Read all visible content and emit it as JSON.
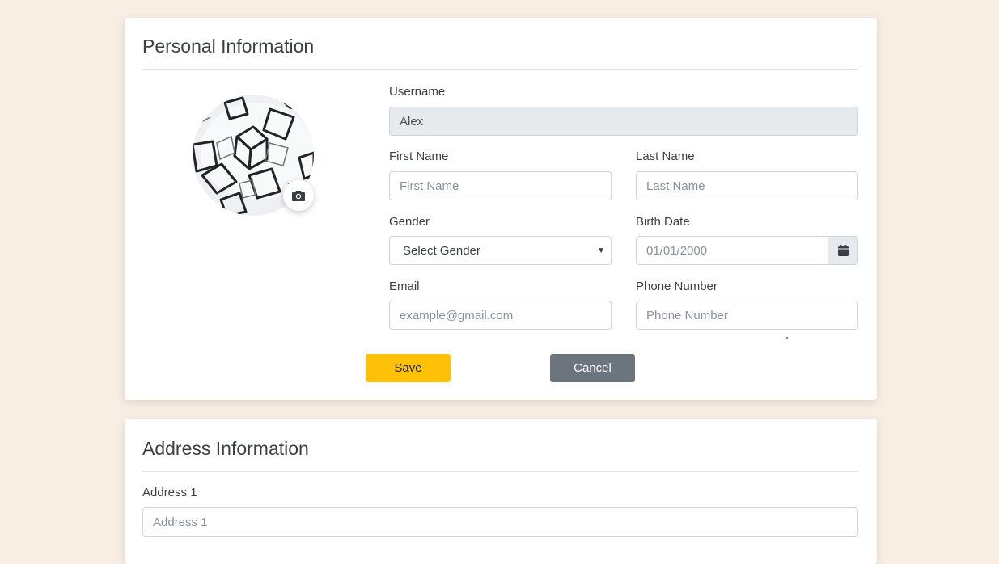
{
  "personal": {
    "title": "Personal Information",
    "username_label": "Username",
    "username_value": "Alex",
    "first_name_label": "First Name",
    "first_name_placeholder": "First Name",
    "last_name_label": "Last Name",
    "last_name_placeholder": "Last Name",
    "gender_label": "Gender",
    "gender_selected": "Select Gender",
    "birth_date_label": "Birth Date",
    "birth_date_placeholder": "01/01/2000",
    "email_label": "Email",
    "email_placeholder": "example@gmail.com",
    "phone_label": "Phone Number",
    "phone_placeholder": "Phone Number",
    "save_label": "Save",
    "cancel_label": "Cancel"
  },
  "address": {
    "title": "Address Information",
    "address1_label": "Address 1",
    "address1_placeholder": "Address 1"
  },
  "icons": {
    "avatar_camera": "camera-icon",
    "birth_date_picker": "calendar-icon",
    "gender_dropdown": "caret-down-icon"
  },
  "colors": {
    "page_background": "#f8eee4",
    "save_button": "#ffc107",
    "cancel_button": "#6c757d",
    "readonly_field": "#e7eaed"
  }
}
